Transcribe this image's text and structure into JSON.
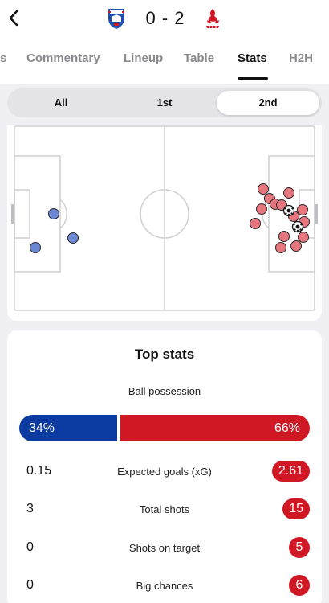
{
  "header": {
    "score": "0 - 2",
    "home_crest": "ipswich-town-crest",
    "away_crest": "liverpool-crest",
    "back_icon": "chevron-left-icon"
  },
  "tabs": [
    {
      "label": "s"
    },
    {
      "label": "Commentary"
    },
    {
      "label": "Lineup"
    },
    {
      "label": "Table"
    },
    {
      "label": "Stats",
      "active": true
    },
    {
      "label": "H2H"
    }
  ],
  "period_segment": {
    "options": [
      "All",
      "1st",
      "2nd"
    ],
    "selected": "2nd"
  },
  "shot_map": {
    "home_color": "#6b86d2",
    "away_color": "#e8767e",
    "home_shots": 3,
    "away_shots": 15,
    "away_goals": 2
  },
  "top_stats": {
    "title": "Top stats",
    "possession": {
      "label": "Ball possession",
      "home": "34%",
      "away": "66%",
      "home_value": 34,
      "away_value": 66,
      "home_color": "#0b3aa0",
      "away_color": "#d01825"
    },
    "rows": [
      {
        "label": "Expected goals (xG)",
        "home": "0.15",
        "away": "2.61"
      },
      {
        "label": "Total shots",
        "home": "3",
        "away": "15"
      },
      {
        "label": "Shots on target",
        "home": "0",
        "away": "5"
      },
      {
        "label": "Big chances",
        "home": "0",
        "away": "6"
      }
    ]
  }
}
